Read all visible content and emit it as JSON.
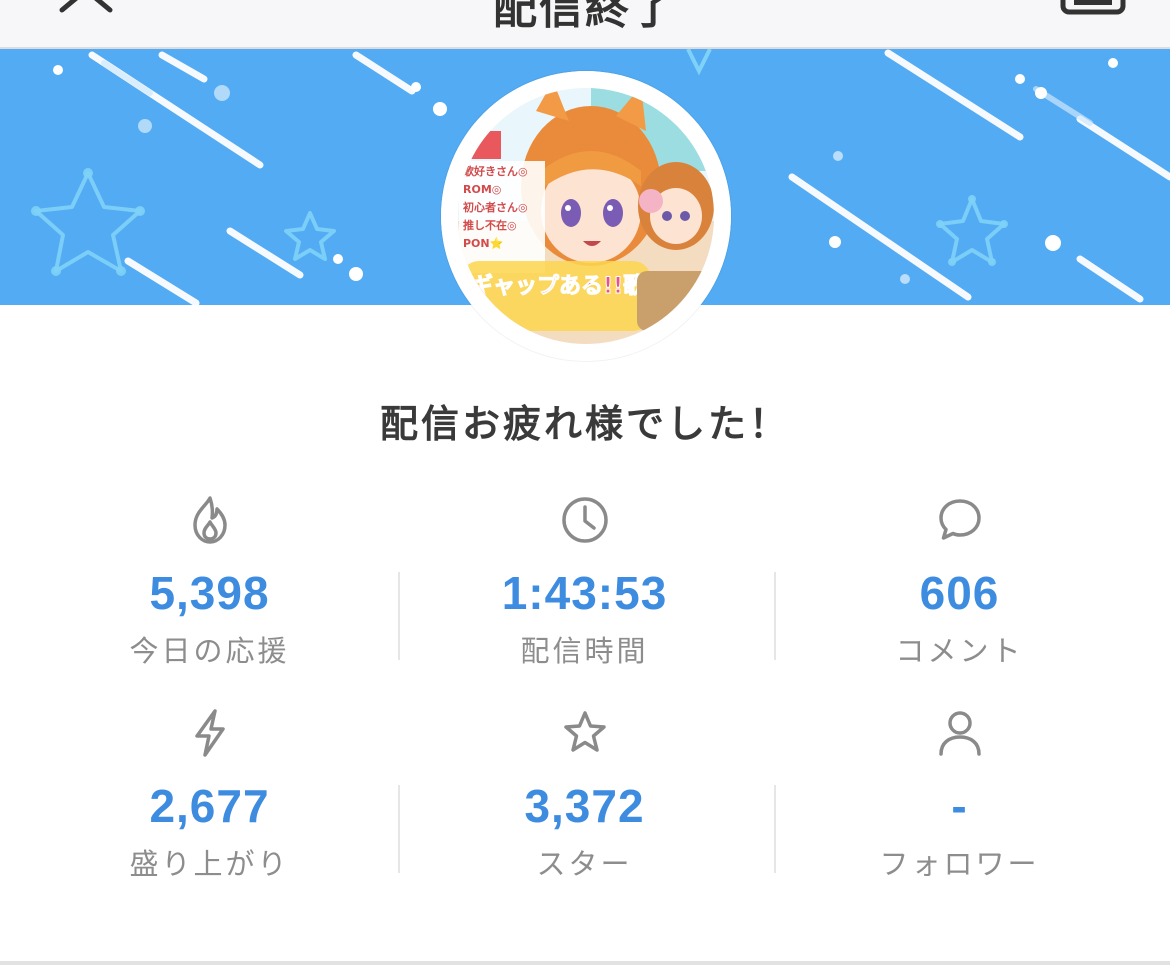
{
  "header": {
    "title": "配信終了",
    "close_icon": "close-icon",
    "keyboard_icon": "keyboard-icon"
  },
  "banner": {
    "background_color": "#52abf3",
    "pattern": "stars-and-streaks"
  },
  "avatar": {
    "caption_lines": [
      "歌好きさん◎",
      "ROM◎",
      "初心者さん◎",
      "推し不在◎",
      "PON⭐"
    ],
    "logo_text": "ギャップある!!歌枠"
  },
  "message": "配信お疲れ様でした！",
  "stats": [
    {
      "icon": "flame-icon",
      "value": "5,398",
      "label": "今日の応援"
    },
    {
      "icon": "clock-icon",
      "value": "1:43:53",
      "label": "配信時間"
    },
    {
      "icon": "comment-icon",
      "value": "606",
      "label": "コメント"
    },
    {
      "icon": "lightning-icon",
      "value": "2,677",
      "label": "盛り上がり"
    },
    {
      "icon": "star-icon",
      "value": "3,372",
      "label": "スター"
    },
    {
      "icon": "user-icon",
      "value": "-",
      "label": "フォロワー"
    }
  ],
  "colors": {
    "value": "#3d8ce0",
    "label": "#8d8d8d",
    "icon": "#8a8a8a"
  }
}
